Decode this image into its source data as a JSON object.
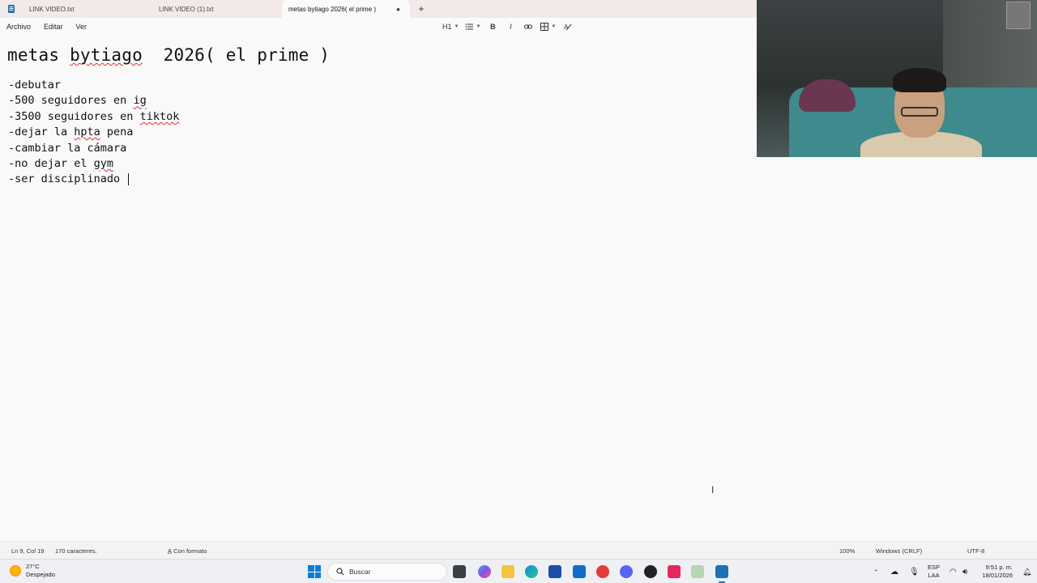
{
  "tabs": [
    {
      "label": "LINK VIDEO.txt"
    },
    {
      "label": "LINK VIDEO (1).txt"
    },
    {
      "label": "metas bytiago  2026( el prime )"
    }
  ],
  "menu": {
    "file": "Archivo",
    "edit": "Editar",
    "view": "Ver"
  },
  "toolbar": {
    "heading": "H1"
  },
  "document": {
    "title": "metas bytiago  2026( el prime )",
    "lines": [
      "-debutar",
      "-500 seguidores en ig",
      "-3500 seguidores en tiktok",
      "-dejar la hpta pena",
      "-cambiar la cámara",
      "-no dejar el gym",
      "-ser disciplinado "
    ]
  },
  "status": {
    "position": "Ln 9, Col 19",
    "chars": "170 caracteres.",
    "format": "Con formato",
    "zoom": "100%",
    "line_ending": "Windows (CRLF)",
    "encoding": "UTF-8"
  },
  "taskbar": {
    "temp": "27°C",
    "condition": "Despejado",
    "search_placeholder": "Buscar",
    "lang_top": "ESP",
    "lang_bottom": "LAA",
    "time": "9:51 p. m.",
    "date": "18/01/2026"
  },
  "colors": {
    "accent": "#0a7cd8",
    "tab_bar": "#f3e9e9",
    "spell_error": "#d33"
  }
}
